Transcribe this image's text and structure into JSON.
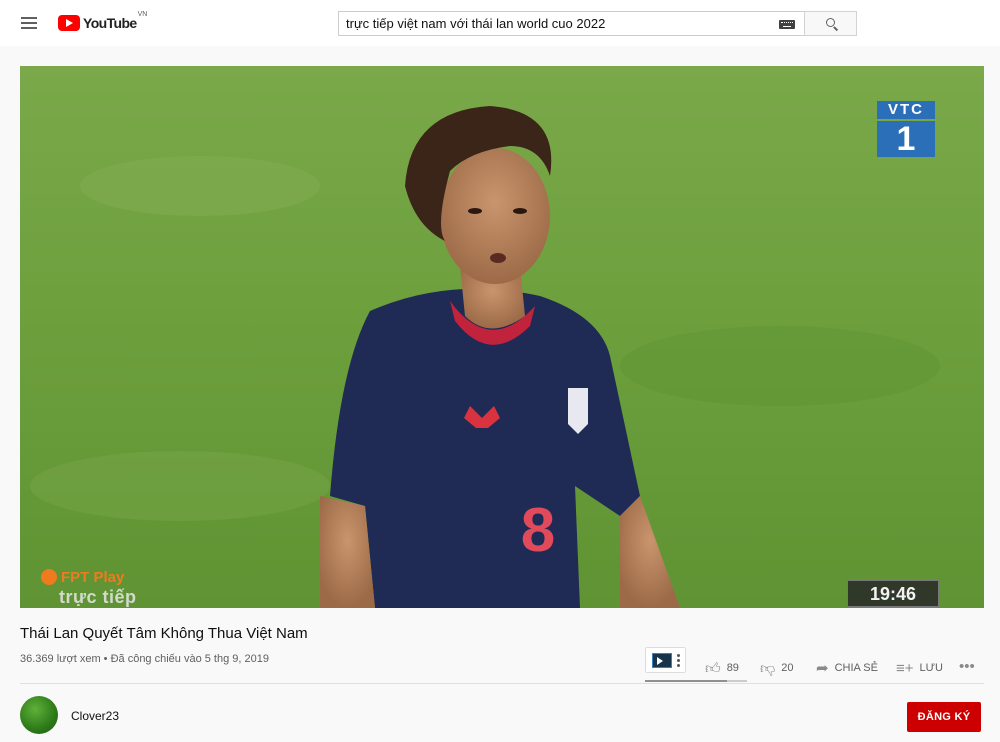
{
  "header": {
    "logo_text": "YouTube",
    "country": "VN",
    "search_value": "trực tiếp việt nam với thái lan world cuo 2022"
  },
  "video": {
    "overlay_channel": "VTC",
    "overlay_number": "1",
    "fpt_brand": "FPT Play",
    "fpt_sub": "trực tiếp",
    "timecode": "19:46",
    "jersey_number": "8"
  },
  "info": {
    "title": "Thái Lan Quyết Tâm Không Thua Việt Nam",
    "meta": "36.369 lượt xem • Đã công chiếu vào 5 thg 9, 2019",
    "likes": "89",
    "dislikes": "20",
    "share_label": "CHIA SẺ",
    "save_label": "LƯU",
    "like_ratio": 0.8
  },
  "channel": {
    "name": "Clover23",
    "subscribe_label": "ĐĂNG KÝ"
  },
  "colors": {
    "brand_red": "#ff0000",
    "subscribe_red": "#cc0000",
    "pitch_green": "#6b9f3a"
  }
}
